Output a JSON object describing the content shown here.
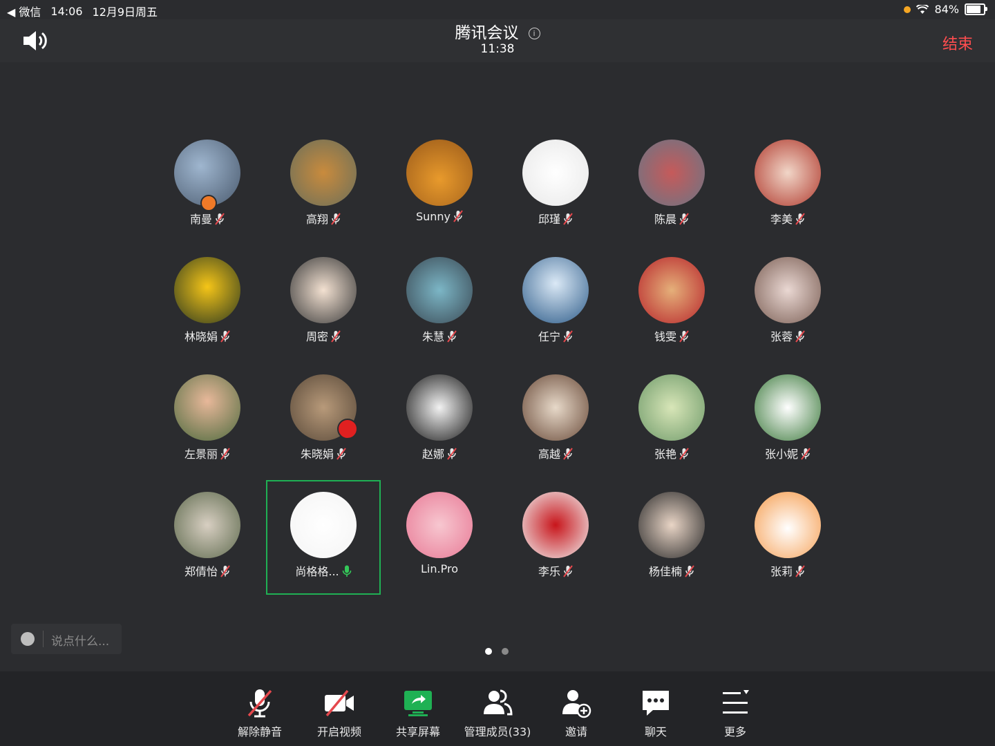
{
  "statusbar": {
    "back_app": "◀ 微信",
    "time": "14:06",
    "date": "12月9日周五",
    "battery": "84%"
  },
  "header": {
    "title": "腾讯会议",
    "timer": "11:38",
    "end_label": "结束"
  },
  "participants": [
    {
      "name": "南曼",
      "mic": "muted"
    },
    {
      "name": "高翔",
      "mic": "muted"
    },
    {
      "name": "Sunny",
      "mic": "muted"
    },
    {
      "name": "邱瑾",
      "mic": "muted"
    },
    {
      "name": "陈晨",
      "mic": "muted"
    },
    {
      "name": "李美",
      "mic": "muted"
    },
    {
      "name": "林晓娟",
      "mic": "muted"
    },
    {
      "name": "周密",
      "mic": "muted"
    },
    {
      "name": "朱慧",
      "mic": "muted"
    },
    {
      "name": "任宁",
      "mic": "muted"
    },
    {
      "name": "钱雯",
      "mic": "muted"
    },
    {
      "name": "张蓉",
      "mic": "muted"
    },
    {
      "name": "左景丽",
      "mic": "muted"
    },
    {
      "name": "朱晓娟",
      "mic": "muted"
    },
    {
      "name": "赵娜",
      "mic": "muted"
    },
    {
      "name": "高越",
      "mic": "muted"
    },
    {
      "name": "张艳",
      "mic": "muted"
    },
    {
      "name": "张小妮",
      "mic": "muted"
    },
    {
      "name": "郑倩怡",
      "mic": "muted"
    },
    {
      "name": "尚格格...",
      "mic": "active"
    },
    {
      "name": "Lin.Pro",
      "mic": "none"
    },
    {
      "name": "李乐",
      "mic": "muted"
    },
    {
      "name": "杨佳楠",
      "mic": "muted"
    },
    {
      "name": "张莉",
      "mic": "muted"
    }
  ],
  "chat_input": {
    "placeholder": "说点什么..."
  },
  "toolbar": {
    "unmute": "解除静音",
    "video": "开启视频",
    "share": "共享屏幕",
    "members": "管理成员(33)",
    "invite": "邀请",
    "chat": "聊天",
    "more": "更多"
  },
  "colors": {
    "end": "#ff4d4f",
    "active_border": "#1fb154",
    "share_icon": "#1fb154",
    "mute_slash": "#e5484d"
  }
}
